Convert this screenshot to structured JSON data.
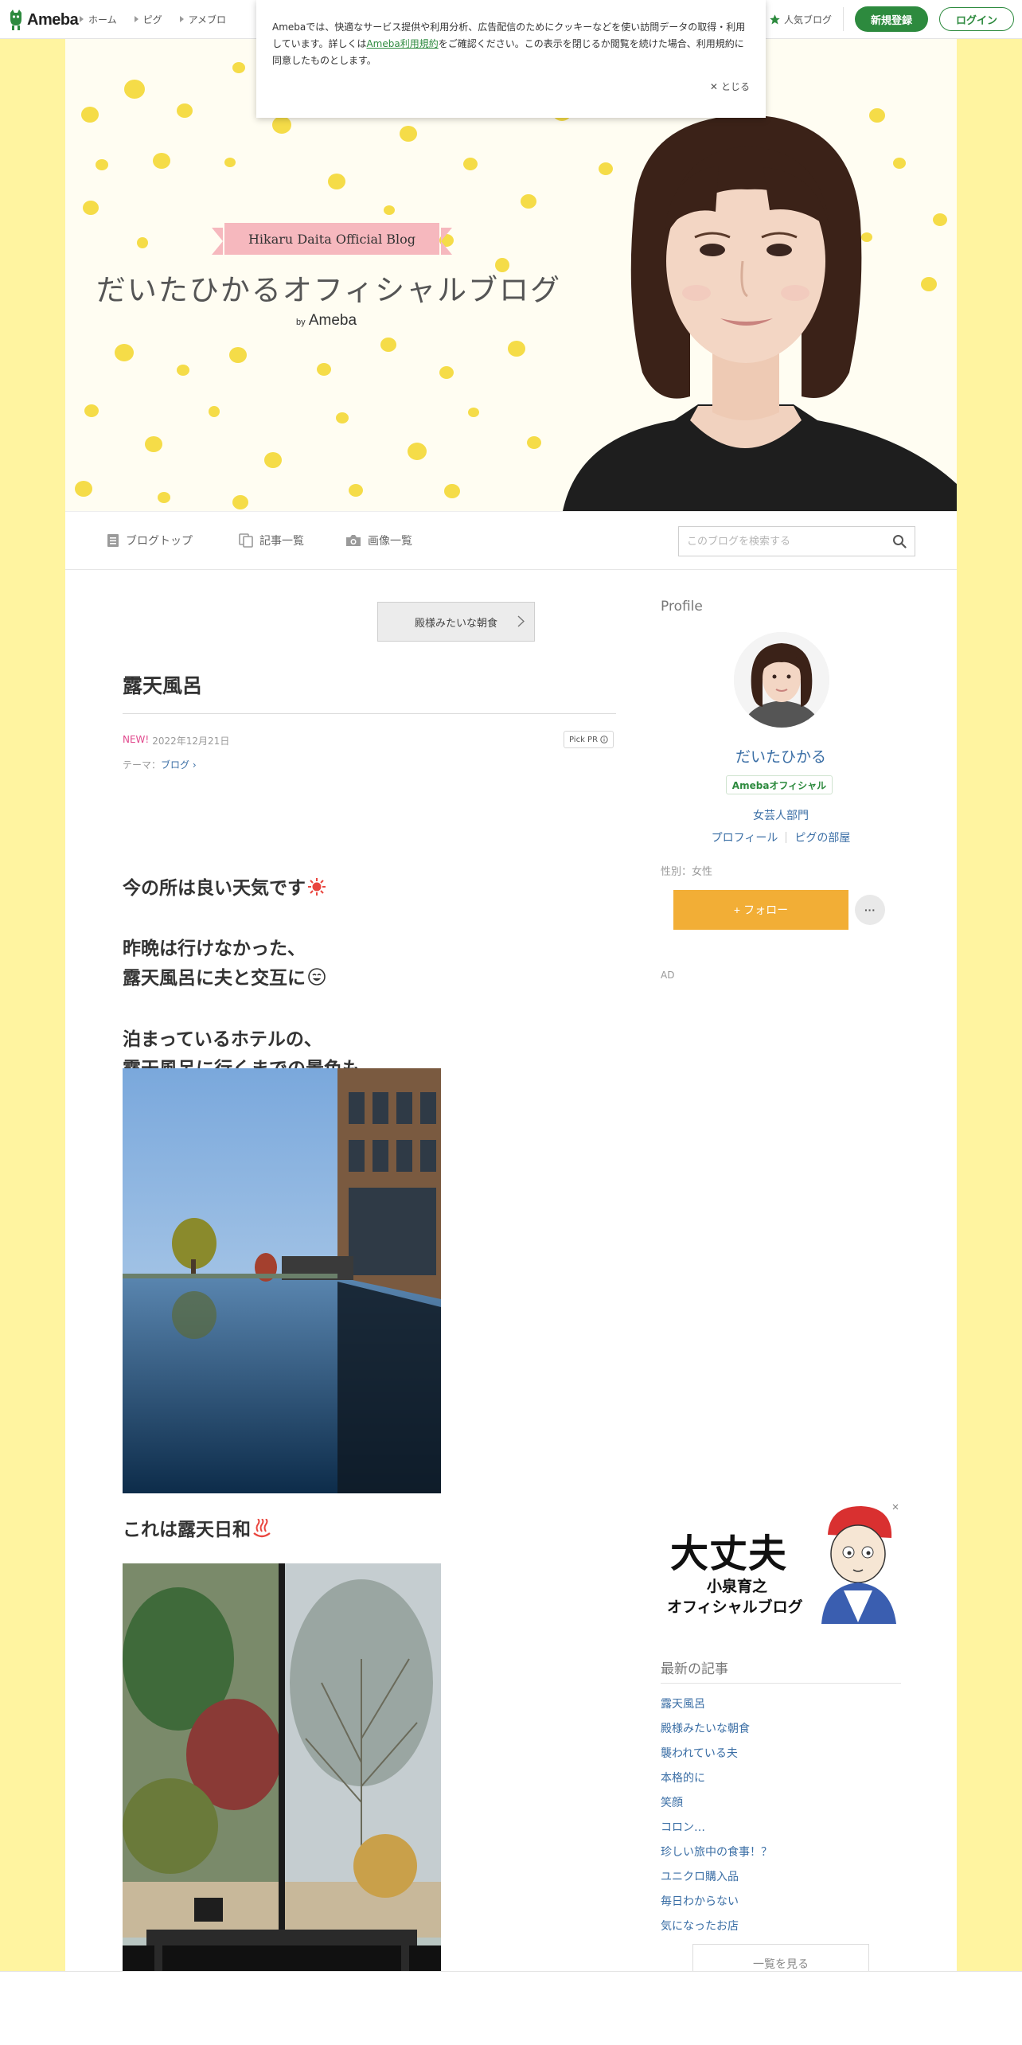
{
  "global_header": {
    "logo_text": "Ameba",
    "nav": [
      "ホーム",
      "ピグ",
      "アメブロ"
    ],
    "popular_blog": "人気ブログ",
    "register": "新規登録",
    "login": "ログイン"
  },
  "cookie_notice": {
    "text_before": "Amebaでは、快適なサービス提供や利用分析、広告配信のためにクッキーなどを使い訪問データの取得・利用しています。詳しくは",
    "link": "Ameba利用規約",
    "text_after": "をご確認ください。この表示を閉じるか閲覧を続けた場合、利用規約に同意したものとします。",
    "close": "とじる"
  },
  "blog_header": {
    "ribbon": "Hikaru Daita Official Blog",
    "title": "だいたひかるオフィシャルブログ",
    "by": "by",
    "brand": "Ameba"
  },
  "blog_nav": {
    "top": "ブログトップ",
    "list": "記事一覧",
    "images": "画像一覧",
    "search_placeholder": "このブログを検索する"
  },
  "article": {
    "prev": "殿様みたいな朝食",
    "title": "露天風呂",
    "new_badge": "NEW!",
    "date": "2022年12月21日",
    "pickpr": "Pick PR",
    "theme_label": "テーマ：",
    "theme": "ブログ",
    "p1": "今の所は良い天気です",
    "p2a": "昨晩は行けなかった、",
    "p2b": "露天風呂に夫と交互に",
    "p3a": "泊まっているホテルの、",
    "p3b": "露天風呂に行くまでの景色も…",
    "p4": "これは露天日和"
  },
  "sidebar": {
    "profile_head": "Profile",
    "name": "だいたひかる",
    "badge": "Amebaオフィシャル",
    "category": "女芸人部門",
    "profile_link": "プロフィール",
    "pig_link": "ピグの部屋",
    "gender": "性別：女性",
    "follow": "フォロー",
    "more": "···",
    "ad": "AD",
    "ad_banner": {
      "line1": "大丈夫",
      "line2": "小泉育之",
      "line3": "オフィシャルブログ"
    },
    "recent_head": "最新の記事",
    "recent": [
      "露天風呂",
      "殿様みたいな朝食",
      "襲われている夫",
      "本格的に",
      "笑顔",
      "コロン…",
      "珍しい旅中の食事！？",
      "ユニクロ購入品",
      "毎日わからない",
      "気になったお店"
    ],
    "see_all": "一覧を見る"
  },
  "colors": {
    "brand_green": "#2d8a3e",
    "follow_orange": "#f2ae36",
    "link_blue": "#3a6ea5",
    "page_yellow": "#fff4a0",
    "ribbon_pink": "#f6b8be"
  }
}
